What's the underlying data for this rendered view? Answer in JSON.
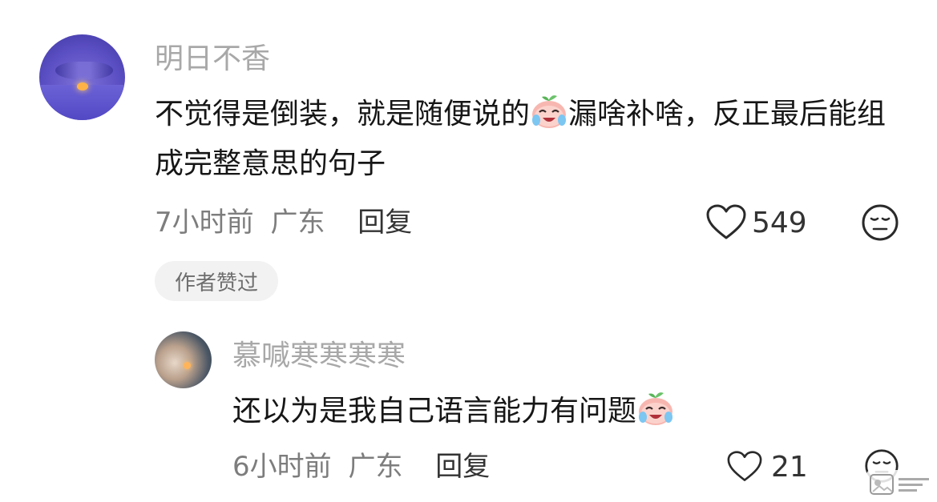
{
  "comment1": {
    "username": "明日不香",
    "text_part1": "不觉得是倒装，就是随便说的",
    "text_part2": "漏啥补啥，反正最后能组成完整意思的句子",
    "time": "7小时前",
    "location": "广东",
    "reply_label": "回复",
    "like_count": "549",
    "badge": "作者赞过"
  },
  "comment2": {
    "username": "慕喊寒寒寒寒",
    "text": "还以为是我自己语言能力有问题",
    "time": "6小时前",
    "location": "广东",
    "reply_label": "回复",
    "like_count": "21"
  },
  "colors": {
    "username": "#a8a8a8",
    "meta": "#7d7d7d",
    "badge_bg": "#f2f2f2",
    "avatar1_accent": "#5b4fc4"
  },
  "icons": {
    "like": "heart-outline-icon",
    "dislike": "meh-face-icon",
    "inline_emoji": "crying-laughing-peach-emoji-icon"
  }
}
